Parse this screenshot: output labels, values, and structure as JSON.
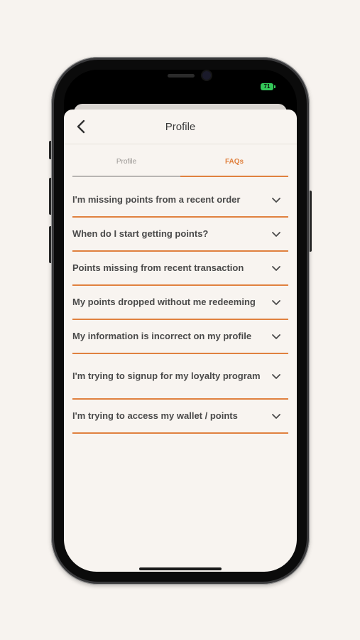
{
  "status_bar": {
    "battery_level": "71",
    "battery_color": "#34c759"
  },
  "header": {
    "title": "Profile",
    "back_icon": "chevron-left-icon"
  },
  "tabs": [
    {
      "label": "Profile",
      "active": false
    },
    {
      "label": "FAQs",
      "active": true
    }
  ],
  "faqs": [
    {
      "question": "I'm missing points from a recent order"
    },
    {
      "question": "When do I start getting points?"
    },
    {
      "question": "Points missing from recent transaction"
    },
    {
      "question": "My points dropped without me redeeming"
    },
    {
      "question": "My information is incorrect on my profile"
    },
    {
      "question": "I'm trying to signup for my loyalty program"
    },
    {
      "question": "I'm trying to access my wallet / points"
    }
  ],
  "colors": {
    "accent": "#e0813f",
    "background": "#f8f4f0",
    "text": "#4a4a4a"
  }
}
